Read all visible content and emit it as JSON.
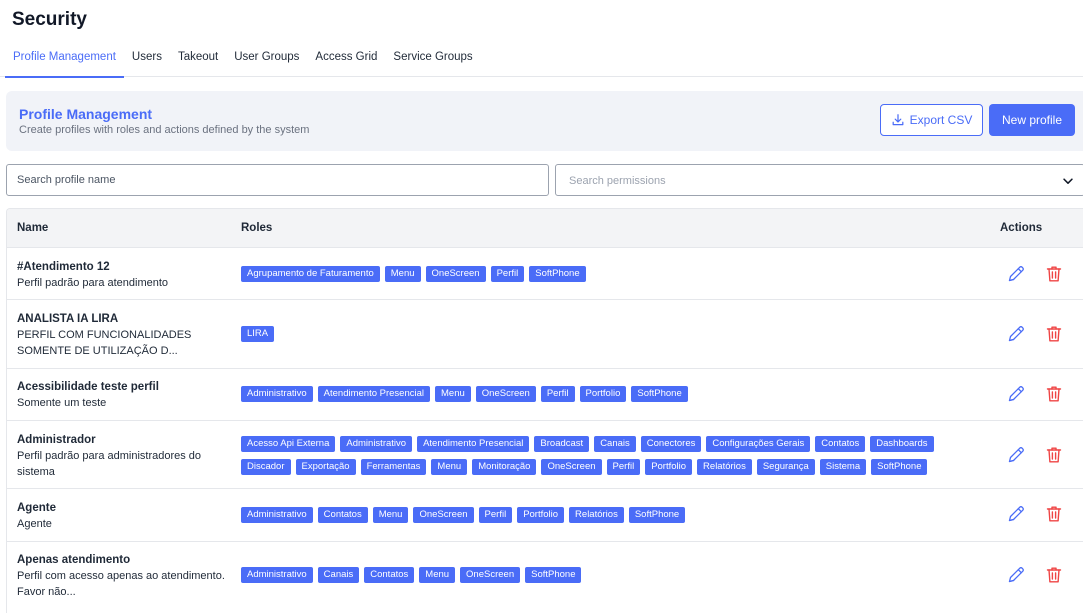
{
  "page": {
    "title": "Security"
  },
  "tabs": [
    {
      "label": "Profile Management",
      "active": true
    },
    {
      "label": "Users",
      "active": false
    },
    {
      "label": "Takeout",
      "active": false
    },
    {
      "label": "User Groups",
      "active": false
    },
    {
      "label": "Access Grid",
      "active": false
    },
    {
      "label": "Service Groups",
      "active": false
    }
  ],
  "header": {
    "title": "Profile Management",
    "subtitle": "Create profiles with roles and actions defined by the system",
    "export_label": "Export CSV",
    "new_label": "New profile"
  },
  "search": {
    "name_placeholder": "Search profile name",
    "permissions_placeholder": "Search permissions"
  },
  "table": {
    "columns": {
      "name": "Name",
      "roles": "Roles",
      "actions": "Actions"
    },
    "rows": [
      {
        "name": "#Atendimento 12",
        "description": "Perfil padrão para atendimento",
        "roles": [
          "Agrupamento de Faturamento",
          "Menu",
          "OneScreen",
          "Perfil",
          "SoftPhone"
        ]
      },
      {
        "name": "ANALISTA IA LIRA",
        "description": "PERFIL COM FUNCIONALIDADES SOMENTE DE UTILIZAÇÃO D...",
        "roles": [
          "LIRA"
        ]
      },
      {
        "name": "Acessibilidade teste perfil",
        "description": "Somente um teste",
        "roles": [
          "Administrativo",
          "Atendimento Presencial",
          "Menu",
          "OneScreen",
          "Perfil",
          "Portfolio",
          "SoftPhone"
        ]
      },
      {
        "name": "Administrador",
        "description": "Perfil padrão para administradores do sistema",
        "roles": [
          "Acesso Api Externa",
          "Administrativo",
          "Atendimento Presencial",
          "Broadcast",
          "Canais",
          "Conectores",
          "Configurações Gerais",
          "Contatos",
          "Dashboards",
          "Discador",
          "Exportação",
          "Ferramentas",
          "Menu",
          "Monitoração",
          "OneScreen",
          "Perfil",
          "Portfolio",
          "Relatórios",
          "Segurança",
          "Sistema",
          "SoftPhone"
        ]
      },
      {
        "name": "Agente",
        "description": "Agente",
        "roles": [
          "Administrativo",
          "Contatos",
          "Menu",
          "OneScreen",
          "Perfil",
          "Portfolio",
          "Relatórios",
          "SoftPhone"
        ]
      },
      {
        "name": "Apenas atendimento",
        "description": "Perfil com acesso apenas ao atendimento. Favor não...",
        "roles": [
          "Administrativo",
          "Canais",
          "Contatos",
          "Menu",
          "OneScreen",
          "SoftPhone"
        ]
      }
    ]
  },
  "icons": {
    "edit": "pencil-icon",
    "delete": "trash-icon",
    "export": "download-icon",
    "dropdown": "chevron-down-icon"
  },
  "colors": {
    "accent": "#4a6cf7",
    "role_badge": "#4a6cf7",
    "delete": "#ef4444",
    "header_bg": "#f1f3f8"
  }
}
